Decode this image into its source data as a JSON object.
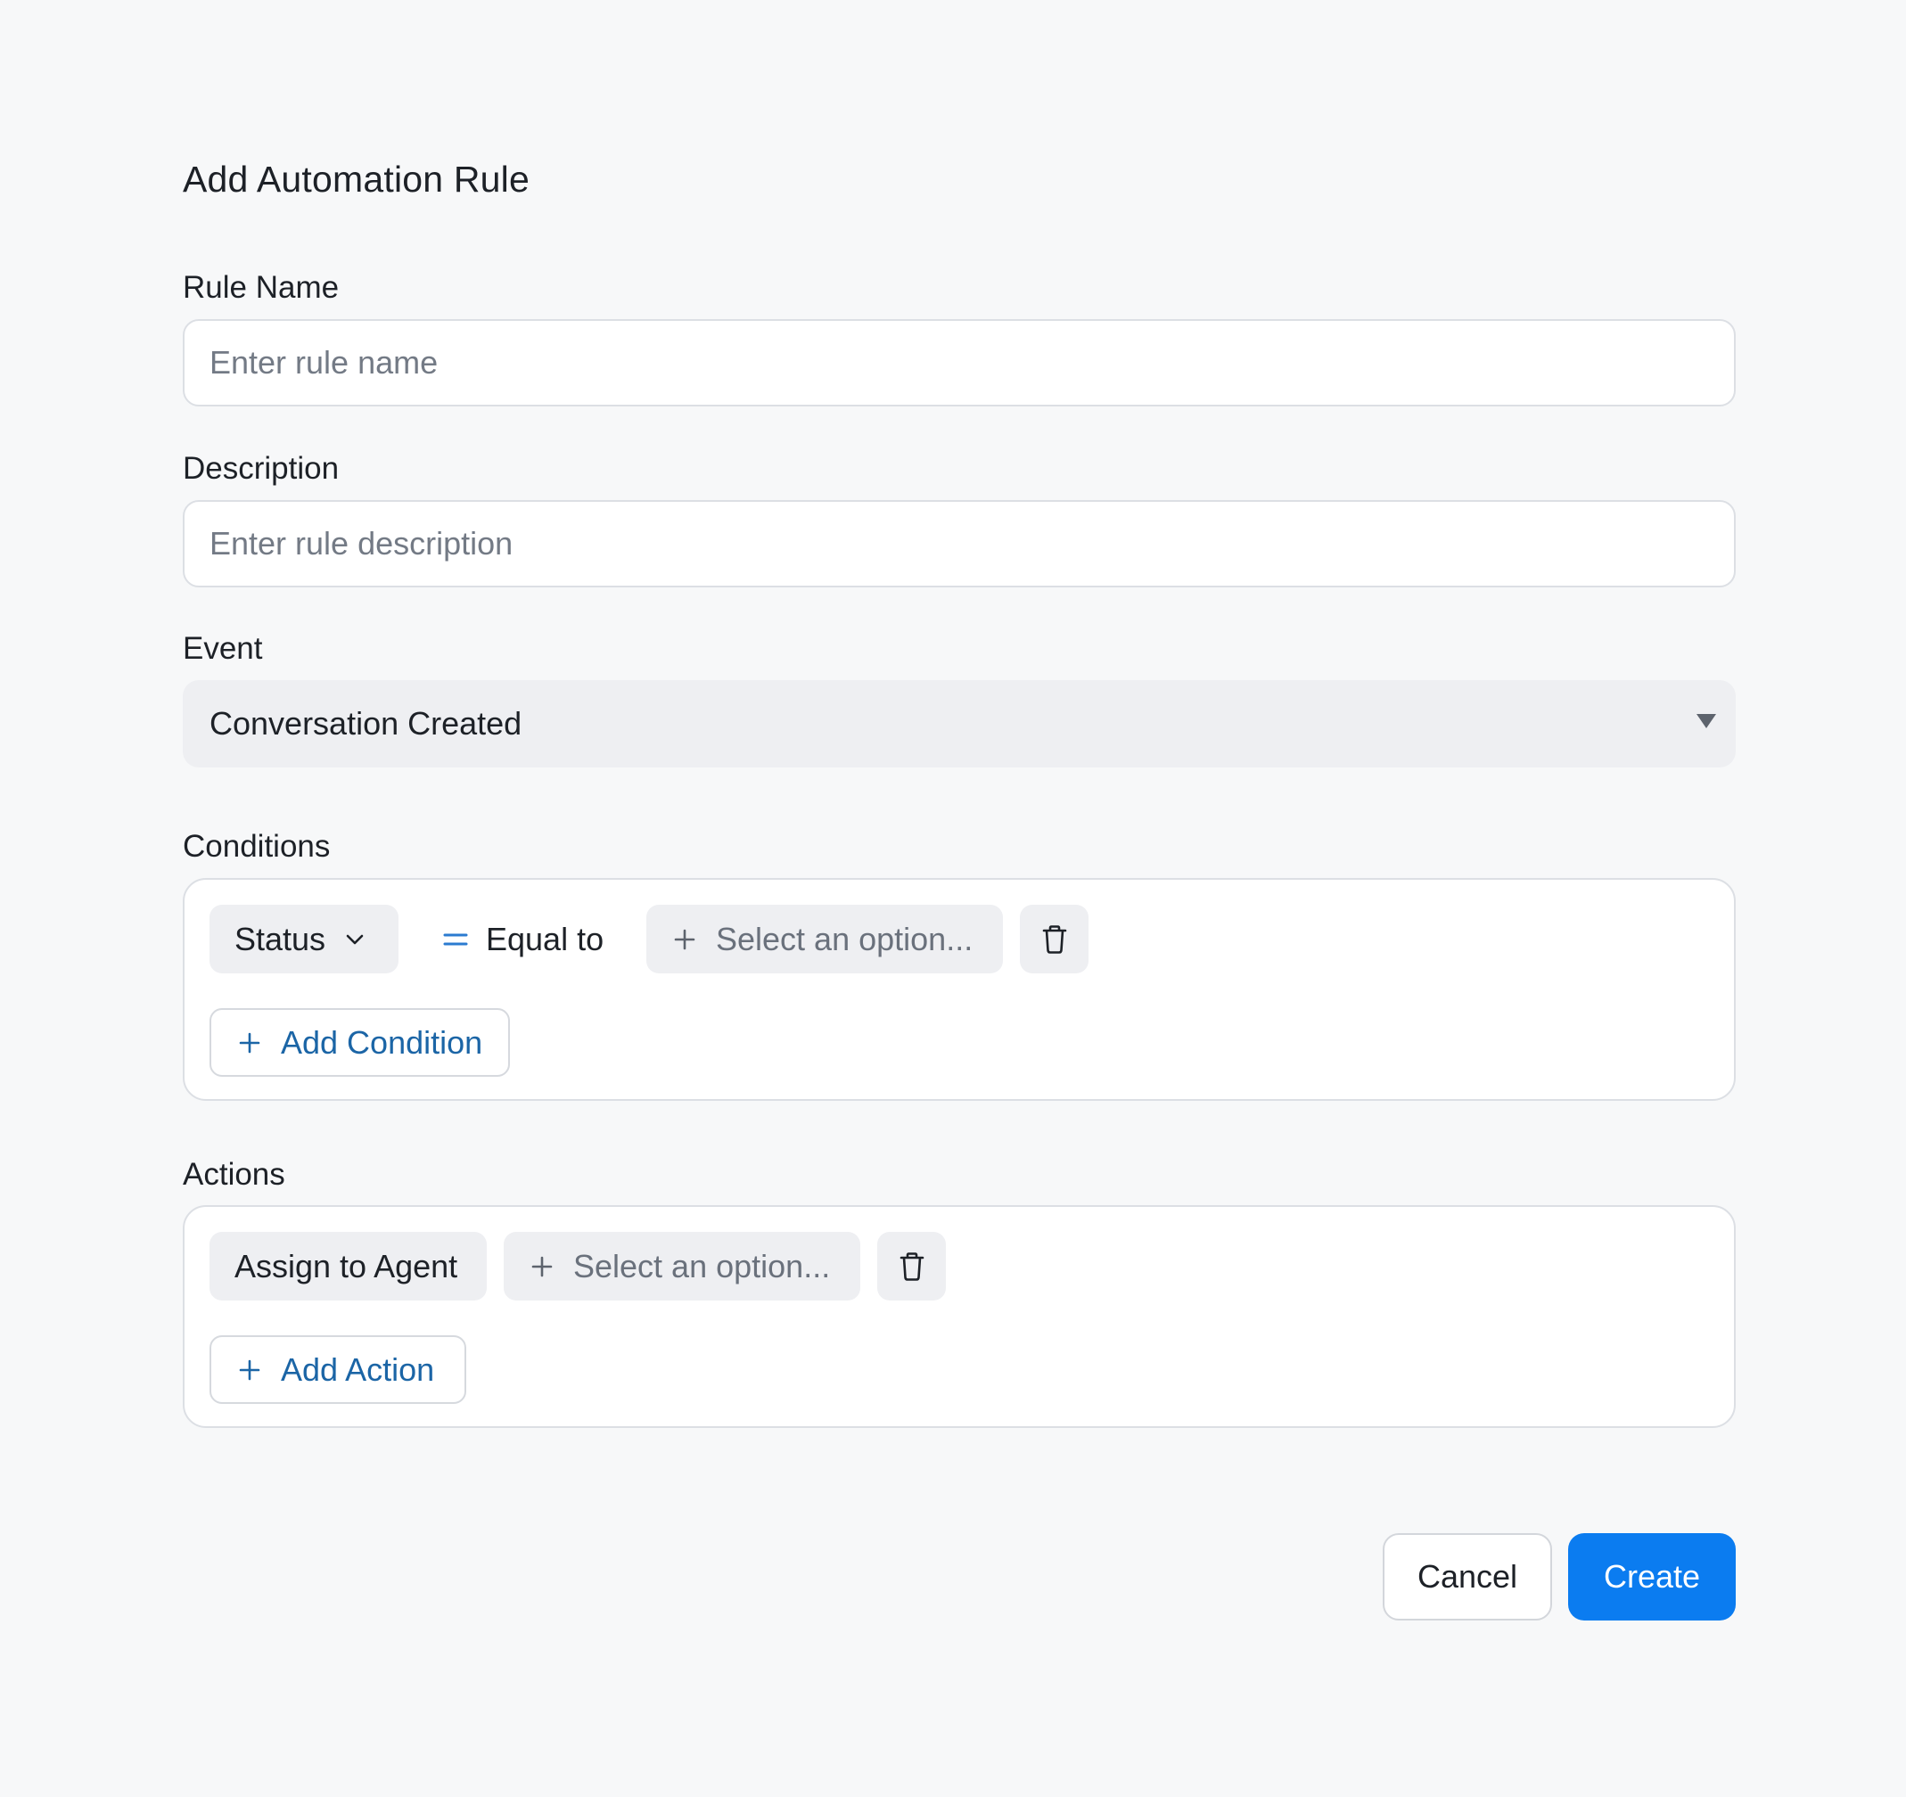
{
  "dialog": {
    "title": "Add Automation Rule"
  },
  "rule_name": {
    "label": "Rule Name",
    "value": "",
    "placeholder": "Enter rule name"
  },
  "description": {
    "label": "Description",
    "value": "",
    "placeholder": "Enter rule description"
  },
  "event": {
    "label": "Event",
    "selected": "Conversation Created",
    "icon": "caret-down-icon"
  },
  "conditions": {
    "label": "Conditions",
    "rows": [
      {
        "attribute": "Status",
        "operator": "Equal to",
        "value_placeholder": "Select an option..."
      }
    ],
    "add_label": "Add Condition"
  },
  "actions": {
    "label": "Actions",
    "rows": [
      {
        "action": "Assign to Agent",
        "value_placeholder": "Select an option..."
      }
    ],
    "add_label": "Add Action"
  },
  "footer": {
    "cancel_label": "Cancel",
    "create_label": "Create"
  },
  "colors": {
    "primary": "#0b7cf0",
    "link": "#1b65a6",
    "operator_icon": "#2b7bd0",
    "chip_bg": "#eeeff2",
    "border": "#dcdfe4"
  }
}
